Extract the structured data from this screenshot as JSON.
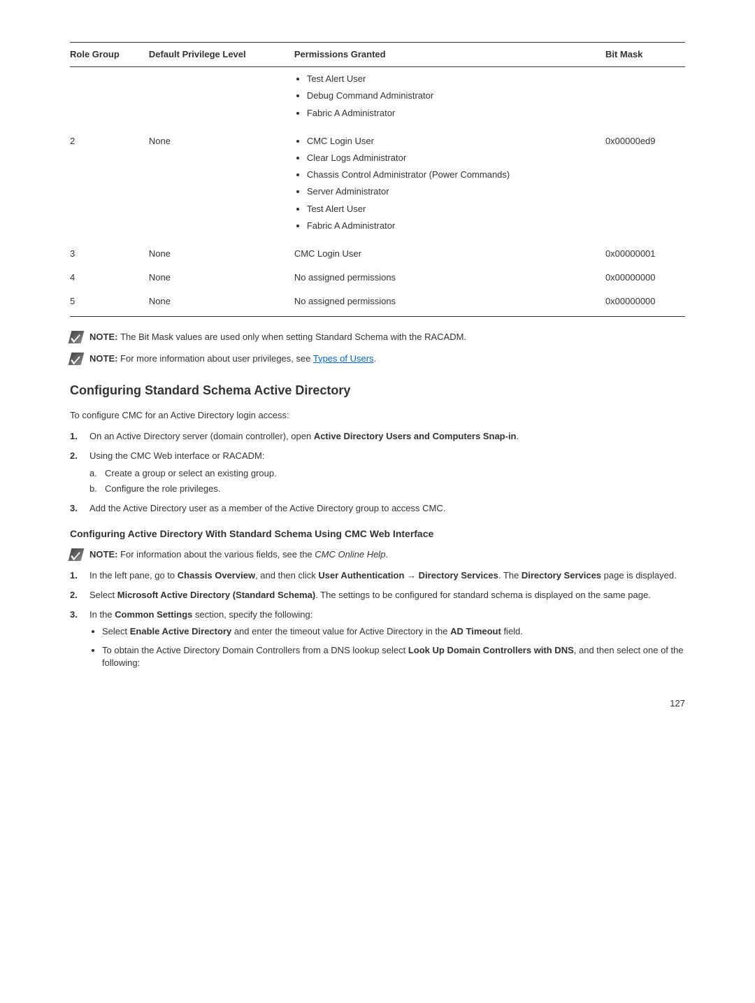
{
  "table": {
    "headers": [
      "Role Group",
      "Default Privilege Level",
      "Permissions Granted",
      "Bit Mask"
    ],
    "rows": [
      {
        "roleGroup": "",
        "privilege": "",
        "permissions": [
          "Test Alert User",
          "Debug Command Administrator",
          "Fabric A Administrator"
        ],
        "bitMask": ""
      },
      {
        "roleGroup": "2",
        "privilege": "None",
        "permissions": [
          "CMC Login User",
          "Clear Logs Administrator",
          "Chassis Control Administrator (Power Commands)",
          "Server Administrator",
          "Test Alert User",
          "Fabric A Administrator"
        ],
        "bitMask": "0x00000ed9"
      },
      {
        "roleGroup": "3",
        "privilege": "None",
        "permissionsText": "CMC Login User",
        "bitMask": "0x00000001"
      },
      {
        "roleGroup": "4",
        "privilege": "None",
        "permissionsText": "No assigned permissions",
        "bitMask": "0x00000000"
      },
      {
        "roleGroup": "5",
        "privilege": "None",
        "permissionsText": "No assigned permissions",
        "bitMask": "0x00000000"
      }
    ]
  },
  "notes": {
    "n1_prefix": "NOTE: ",
    "n1_text": "The Bit Mask values are used only when setting Standard Schema with the RACADM.",
    "n2_prefix": "NOTE: ",
    "n2_text": "For more information about user privileges, see ",
    "n2_link": "Types of Users",
    "n2_suffix": "."
  },
  "heading2": "Configuring Standard Schema Active Directory",
  "intro": "To configure CMC for an Active Directory login access:",
  "steps1": {
    "s1a": "On an Active Directory server (domain controller), open ",
    "s1b": "Active Directory Users and Computers Snap-in",
    "s1c": ".",
    "s2": "Using the CMC Web interface or RACADM:",
    "s2a": "Create a group or select an existing group.",
    "s2b": "Configure the role privileges.",
    "s3": "Add the Active Directory user as a member of the Active Directory group to access CMC."
  },
  "heading3": "Configuring Active Directory With Standard Schema Using CMC Web Interface",
  "notes2": {
    "prefix": "NOTE: ",
    "text": "For information about the various fields, see the ",
    "em": "CMC Online Help",
    "suffix": "."
  },
  "steps2": {
    "s1a": "In the left pane, go to ",
    "s1b": "Chassis Overview",
    "s1c": ", and then click ",
    "s1d": "User Authentication",
    "s1arrow": " → ",
    "s1e": "Directory Services",
    "s1f": ". The ",
    "s1g": "Directory Services",
    "s1h": " page is displayed.",
    "s2a": "Select ",
    "s2b": "Microsoft Active Directory (Standard Schema)",
    "s2c": ". The settings to be configured for standard schema is displayed on the same page.",
    "s3a": "In the ",
    "s3b": "Common Settings",
    "s3c": " section, specify the following:",
    "b1a": "Select ",
    "b1b": "Enable Active Directory",
    "b1c": " and enter the timeout value for Active Directory in the ",
    "b1d": "AD Timeout",
    "b1e": " field.",
    "b2a": "To obtain the Active Directory Domain Controllers from a DNS lookup select ",
    "b2b": "Look Up Domain Controllers with DNS",
    "b2c": ", and then select one of the following:"
  },
  "pageNumber": "127"
}
